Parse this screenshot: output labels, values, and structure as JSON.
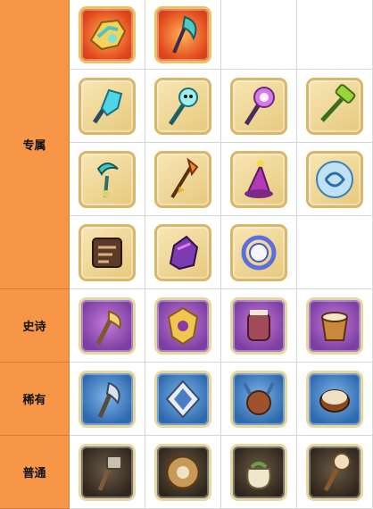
{
  "categories": {
    "exclusive": "专属",
    "epic": "史诗",
    "rare": "稀有",
    "common": "普通"
  },
  "items": {
    "exclusive": [
      [
        "golden-gauntlet-icon",
        "crescent-axe-icon"
      ],
      [
        "ice-crystal-club-icon",
        "frost-skull-staff-icon",
        "arcane-skull-scepter-icon",
        "green-hammer-icon"
      ],
      [
        "crescent-wand-icon",
        "flame-trident-icon",
        "witch-hat-staff-icon",
        "blue-swirl-orb-icon"
      ],
      [
        "ancient-scroll-icon",
        "violet-fist-icon",
        "rune-ring-icon"
      ]
    ],
    "epic": [
      "feather-axe-icon",
      "golden-emblem-icon",
      "warrior-gauntlet-icon",
      "war-drum-icon"
    ],
    "rare": [
      "steel-axe-icon",
      "silver-emblem-icon",
      "horned-gauntlet-icon",
      "tribal-drum-icon"
    ],
    "common": [
      "wooden-hatchet-icon",
      "round-shield-icon",
      "cloth-sack-icon",
      "bone-mace-icon"
    ]
  },
  "colors": {
    "category_bg": "#f79646",
    "epic": "#7b3fa1",
    "rare": "#2f6aae",
    "common": "#2e251c",
    "exclusive_frame": "#d9b768"
  }
}
